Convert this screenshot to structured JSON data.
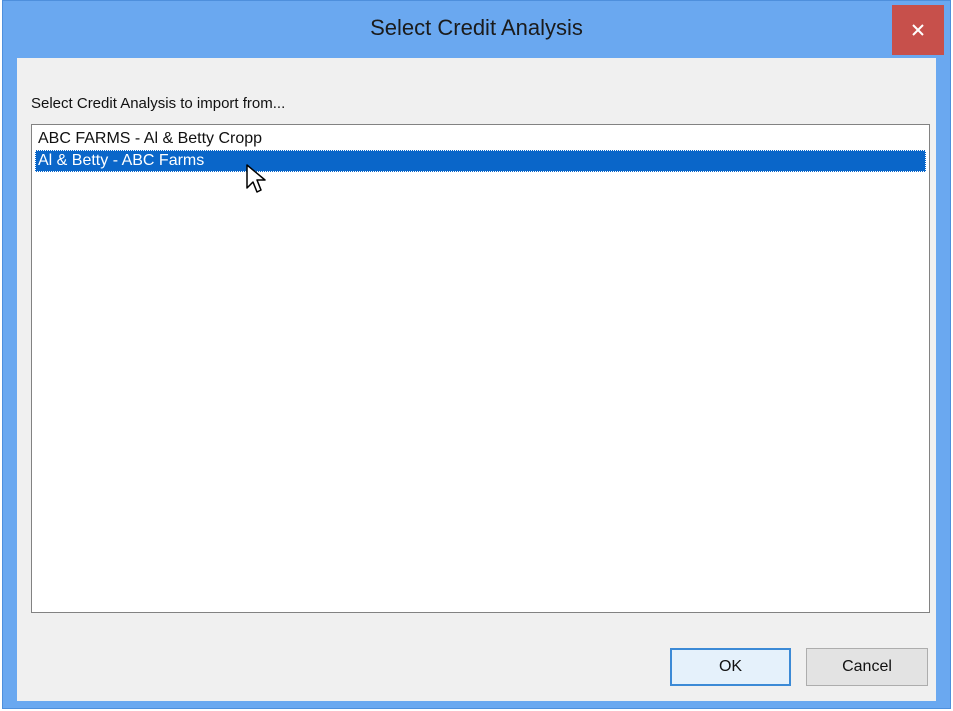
{
  "window": {
    "title": "Select Credit Analysis",
    "close_symbol": "✕"
  },
  "dialog": {
    "prompt": "Select Credit Analysis to import from...",
    "items": [
      {
        "label": "ABC FARMS - Al & Betty Cropp",
        "selected": false
      },
      {
        "label": "Al & Betty - ABC Farms",
        "selected": true
      }
    ],
    "ok_label": "OK",
    "cancel_label": "Cancel"
  },
  "icons": {
    "close": "close-icon",
    "cursor": "mouse-pointer-icon"
  },
  "colors": {
    "titlebar": "#6aa8f0",
    "close_button": "#c7504b",
    "selection": "#0a66c9",
    "ok_border": "#3c8ad6"
  }
}
